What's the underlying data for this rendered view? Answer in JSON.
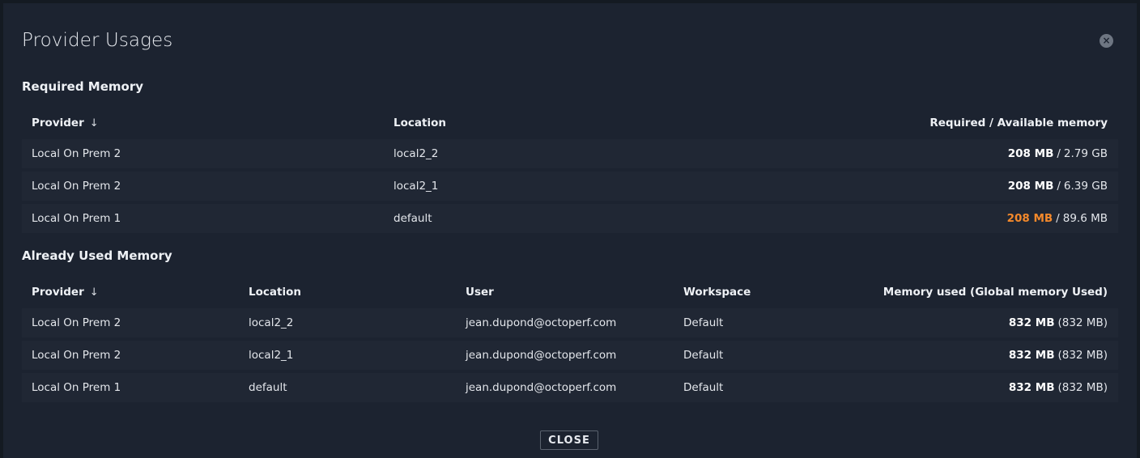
{
  "dialog": {
    "title": "Provider Usages",
    "close_icon": "close-icon",
    "close_button_label": "CLOSE"
  },
  "required": {
    "title": "Required Memory",
    "headers": {
      "provider": "Provider",
      "location": "Location",
      "memory": "Required / Available memory"
    },
    "sort_icon": "arrow-down-icon",
    "rows": [
      {
        "provider": "Local On Prem 2",
        "location": "local2_2",
        "required": "208 MB",
        "separator": "/",
        "available": "2.79 GB",
        "warning": false
      },
      {
        "provider": "Local On Prem 2",
        "location": "local2_1",
        "required": "208 MB",
        "separator": "/",
        "available": "6.39 GB",
        "warning": false
      },
      {
        "provider": "Local On Prem 1",
        "location": "default",
        "required": "208 MB",
        "separator": "/",
        "available": "89.6 MB",
        "warning": true
      }
    ]
  },
  "used": {
    "title": "Already Used Memory",
    "headers": {
      "provider": "Provider",
      "location": "Location",
      "user": "User",
      "workspace": "Workspace",
      "memory": "Memory used (Global memory Used)"
    },
    "rows": [
      {
        "provider": "Local On Prem 2",
        "location": "local2_2",
        "user": "jean.dupond@octoperf.com",
        "workspace": "Default",
        "used": "832 MB",
        "global": "(832 MB)"
      },
      {
        "provider": "Local On Prem 2",
        "location": "local2_1",
        "user": "jean.dupond@octoperf.com",
        "workspace": "Default",
        "used": "832 MB",
        "global": "(832 MB)"
      },
      {
        "provider": "Local On Prem 1",
        "location": "default",
        "user": "jean.dupond@octoperf.com",
        "workspace": "Default",
        "used": "832 MB",
        "global": "(832 MB)"
      }
    ]
  },
  "colors": {
    "background": "#1c2330",
    "row": "#202734",
    "warning": "#f4892b"
  }
}
